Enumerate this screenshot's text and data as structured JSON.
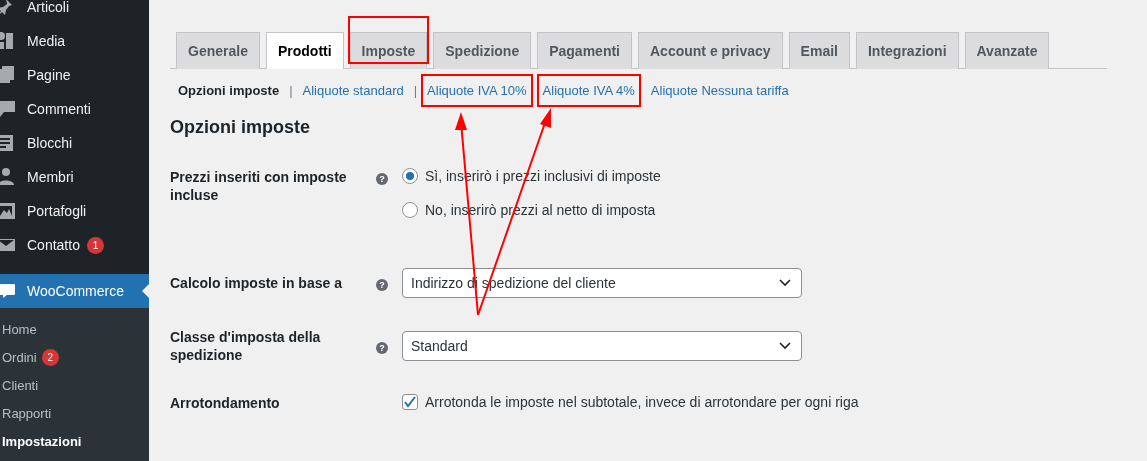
{
  "sidebar": {
    "items": [
      {
        "label": "Articoli",
        "selected": false
      },
      {
        "label": "Media",
        "selected": false
      },
      {
        "label": "Pagine",
        "selected": false
      },
      {
        "label": "Commenti",
        "selected": false
      },
      {
        "label": "Blocchi",
        "selected": false
      },
      {
        "label": "Membri",
        "selected": false
      },
      {
        "label": "Portafogli",
        "selected": false
      },
      {
        "label": "Contatto",
        "selected": false,
        "badge": "1"
      },
      {
        "label": "WooCommerce",
        "selected": true
      }
    ],
    "submenu": [
      {
        "label": "Home",
        "selected": false
      },
      {
        "label": "Ordini",
        "selected": false,
        "badge": "2"
      },
      {
        "label": "Clienti",
        "selected": false
      },
      {
        "label": "Rapporti",
        "selected": false
      },
      {
        "label": "Impostazioni",
        "selected": true
      }
    ]
  },
  "tabs": [
    {
      "label": "Generale",
      "selected": false,
      "highlighted": false
    },
    {
      "label": "Prodotti",
      "selected": true,
      "highlighted": false
    },
    {
      "label": "Imposte",
      "selected": false,
      "highlighted": true
    },
    {
      "label": "Spedizione",
      "selected": false,
      "highlighted": false
    },
    {
      "label": "Pagamenti",
      "selected": false,
      "highlighted": false
    },
    {
      "label": "Account e privacy",
      "selected": false,
      "highlighted": false
    },
    {
      "label": "Email",
      "selected": false,
      "highlighted": false
    },
    {
      "label": "Integrazioni",
      "selected": false,
      "highlighted": false
    },
    {
      "label": "Avanzate",
      "selected": false,
      "highlighted": false
    }
  ],
  "subsections": [
    {
      "label": "Opzioni imposte",
      "selected": true,
      "highlighted": false
    },
    {
      "label": "Aliquote standard",
      "selected": false,
      "separator": "|",
      "highlighted": false
    },
    {
      "label": "Aliquote IVA 10%",
      "selected": false,
      "separator": "|",
      "highlighted": true
    },
    {
      "label": "Aliquote IVA 4%",
      "selected": false,
      "highlighted": true
    },
    {
      "label": "Aliquote Nessuna tariffa",
      "selected": false,
      "highlighted": false
    }
  ],
  "heading": "Opzioni imposte",
  "fields": [
    {
      "kind": "radio",
      "label": "Prezzi inseriti con imposte incluse",
      "help": "?",
      "options": [
        {
          "label": "Sì, inserirò i prezzi inclusivi di imposte",
          "selected": true
        },
        {
          "label": "No, inserirò prezzi al netto di imposta",
          "selected": false
        }
      ]
    },
    {
      "kind": "select",
      "label": "Calcolo imposte in base a",
      "help": "?",
      "value": "Indirizzo di spedizione del cliente"
    },
    {
      "kind": "select",
      "label": "Classe d'imposta della spedizione",
      "help": "?",
      "value": "Standard"
    },
    {
      "kind": "checkbox",
      "label": "Arrotondamento",
      "text": "Arrotonda le imposte nel subtotale, invece di arrotondare per ogni riga",
      "checked": true
    }
  ]
}
